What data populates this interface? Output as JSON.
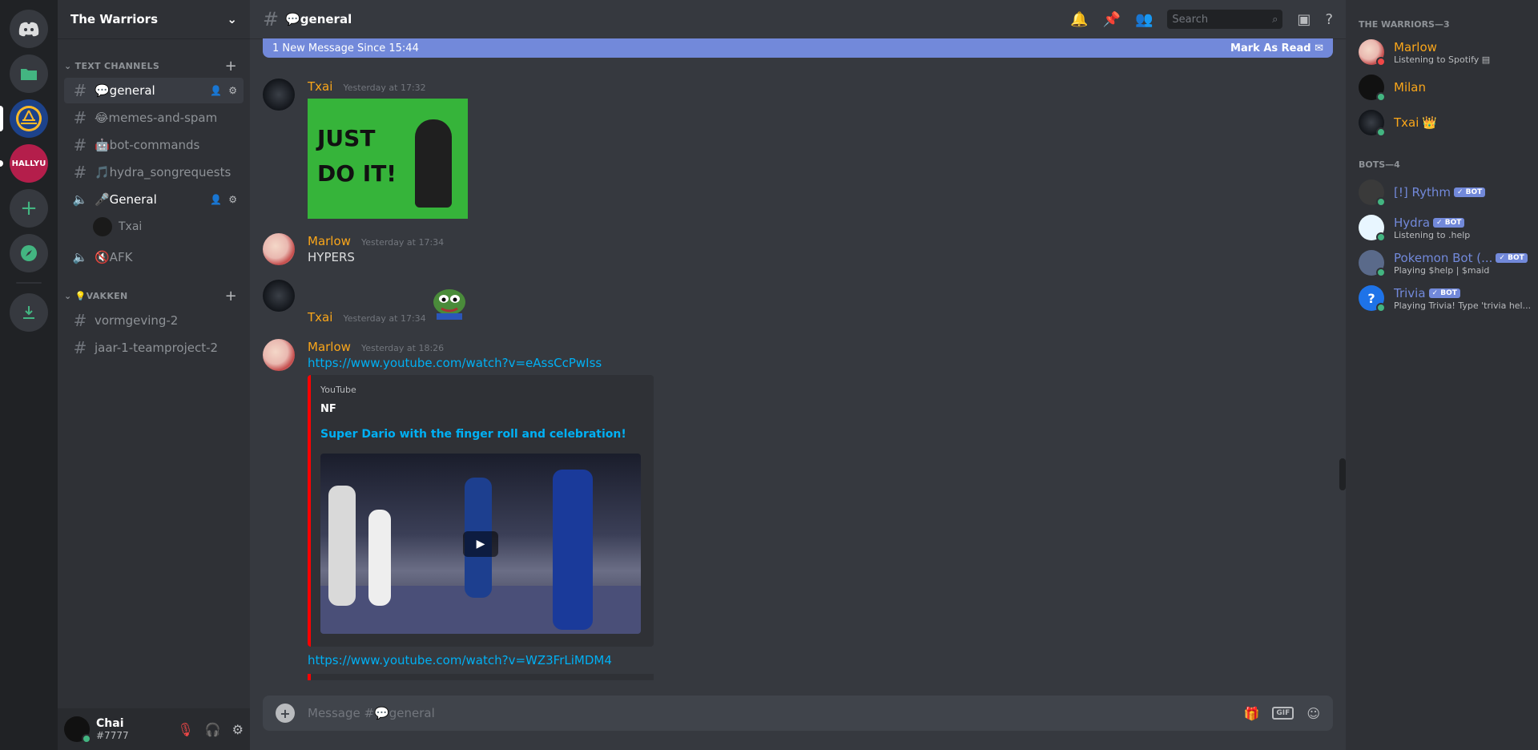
{
  "server": {
    "name": "The Warriors"
  },
  "rail": {
    "hallyu_label": "HALLYU"
  },
  "categories": {
    "text": "TEXT CHANNELS",
    "vakken": "💡VAKKEN"
  },
  "channels": {
    "general": "💬general",
    "memes": "😂memes-and-spam",
    "bot": "🤖bot-commands",
    "hydra": "🎵hydra_songrequests",
    "voice_general": "🎤General",
    "voice_user": "Txai",
    "afk": "🔇AFK",
    "vormgeving": "vormgeving-2",
    "jaar": "jaar-1-teamproject-2"
  },
  "user": {
    "name": "Chai",
    "tag": "#7777"
  },
  "topbar": {
    "title": "💬general",
    "search_placeholder": "Search"
  },
  "banner": {
    "text": "1 New Message Since 15:44",
    "action": "Mark As Read"
  },
  "messages": [
    {
      "author": "Txai",
      "time": "Yesterday at 17:32"
    },
    {
      "author": "Marlow",
      "time": "Yesterday at 17:34",
      "text": "HYPERS"
    },
    {
      "author": "Txai",
      "time": "Yesterday at 17:34"
    },
    {
      "author": "Marlow",
      "time": "Yesterday at 18:26",
      "link1": "https://www.youtube.com/watch?v=eAssCcPwIss",
      "embed_provider": "YouTube",
      "embed_author": "NF",
      "embed_title": "Super Dario with the finger roll and celebration!",
      "link2": "https://www.youtube.com/watch?v=WZ3FrLiMDM4"
    }
  ],
  "gif_text": {
    "line1": "JUST",
    "line2": "DO IT!"
  },
  "composer": {
    "placeholder": "Message #💬general"
  },
  "members": {
    "warriors_header": "THE WARRIORS—3",
    "bots_header": "BOTS—4",
    "list": [
      {
        "name": "Marlow",
        "sub": "Listening to Spotify"
      },
      {
        "name": "Milan"
      },
      {
        "name": "Txai"
      }
    ],
    "bots": [
      {
        "name": "[!] Rythm",
        "badge": "✓ BOT"
      },
      {
        "name": "Hydra",
        "badge": "✓ BOT",
        "sub": "Listening to .help"
      },
      {
        "name": "Pokemon Bot (...",
        "badge": "✓ BOT",
        "sub": "Playing $help | $maid"
      },
      {
        "name": "Trivia",
        "badge": "✓ BOT",
        "sub": "Playing Trivia! Type 'trivia hel..."
      }
    ]
  },
  "colors": {
    "accent": "#7289da",
    "username": "#faa61a",
    "bot_name": "#7289da",
    "online": "#43b581"
  }
}
